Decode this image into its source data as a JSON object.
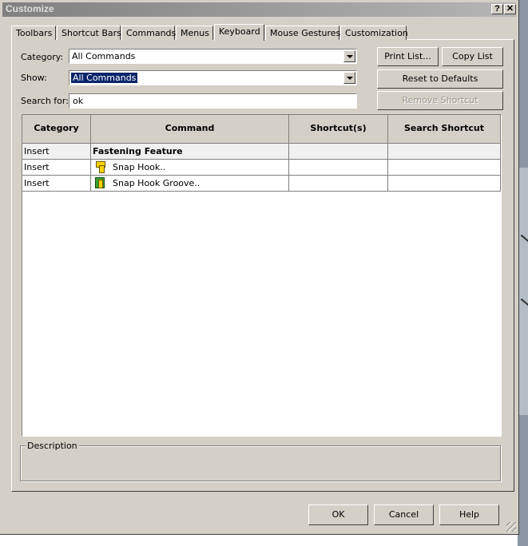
{
  "window": {
    "title": "Customize",
    "help_btn": "?",
    "close_btn": "✕"
  },
  "tabs": [
    "Toolbars",
    "Shortcut Bars",
    "Commands",
    "Menus",
    "Keyboard",
    "Mouse Gestures",
    "Customization"
  ],
  "active_tab": "Keyboard",
  "form": {
    "category_label": "Category:",
    "category_value": "All Commands",
    "show_label": "Show:",
    "show_value": "All Commands",
    "search_label": "Search for:",
    "search_value": "ok"
  },
  "buttons": {
    "print_list": "Print List...",
    "copy_list": "Copy List",
    "reset_defaults": "Reset to Defaults",
    "remove_shortcut": "Remove Shortcut",
    "ok": "OK",
    "cancel": "Cancel",
    "help": "Help"
  },
  "table": {
    "headers": [
      "Category",
      "Command",
      "Shortcut(s)",
      "Search Shortcut"
    ],
    "rows": [
      {
        "category": "Insert",
        "command": "Fastening Feature",
        "shortcut": "",
        "search": "",
        "icon": "",
        "bold": true
      },
      {
        "category": "Insert",
        "command": "Snap Hook..",
        "shortcut": "",
        "search": "",
        "icon": "snap-hook-icon"
      },
      {
        "category": "Insert",
        "command": "Snap Hook Groove..",
        "shortcut": "",
        "search": "",
        "icon": "snap-hook-groove-icon"
      }
    ]
  },
  "description_label": "Description",
  "colors": {
    "dialog_bg": "#d4d0c8",
    "selection": "#0a246a",
    "titlebar": "#808080"
  }
}
